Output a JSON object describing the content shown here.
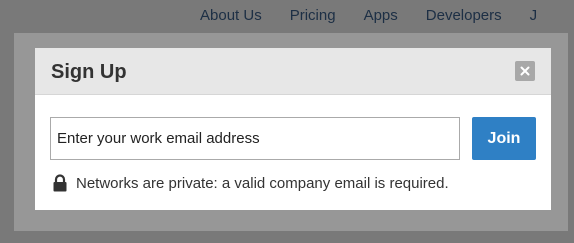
{
  "background_nav": {
    "items": [
      "About Us",
      "Pricing",
      "Apps",
      "Developers",
      "J"
    ]
  },
  "modal": {
    "title": "Sign Up",
    "close_icon": "close-icon",
    "email_input": {
      "value": "",
      "placeholder": "Enter your work email address"
    },
    "join_label": "Join",
    "privacy_icon": "lock-icon",
    "privacy_text": "Networks are private: a valid company email is required."
  },
  "colors": {
    "accent": "#2f80c5",
    "header_bg": "#e7e7e7",
    "overlay": "#808080"
  }
}
